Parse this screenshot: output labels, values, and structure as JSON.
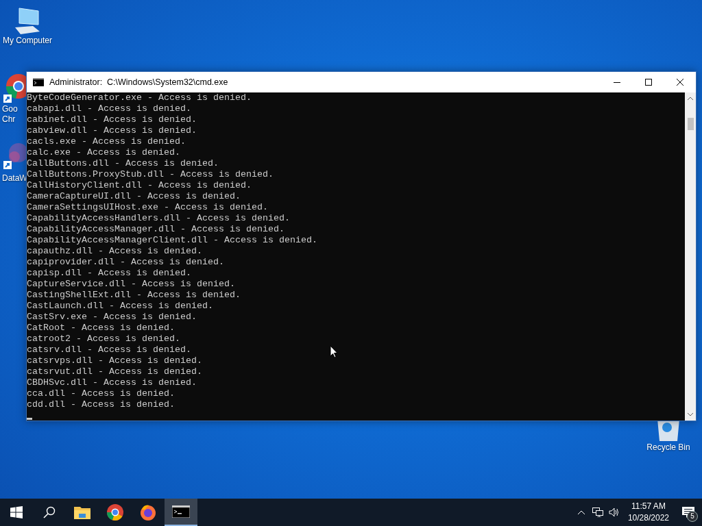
{
  "desktop": {
    "icons": [
      {
        "kind": "computer",
        "label_lines": [
          "My Computer"
        ]
      },
      {
        "kind": "chrome",
        "label_lines": [
          "Goo",
          "Chr"
        ]
      },
      {
        "kind": "app",
        "label_lines": [
          "DataW"
        ]
      },
      {
        "kind": "recycle",
        "label_lines": [
          "Recycle Bin"
        ]
      }
    ]
  },
  "window": {
    "title": "Administrator:  C:\\Windows\\System32\\cmd.exe",
    "lines": [
      "ByteCodeGenerator.exe - Access is denied.",
      "cabapi.dll - Access is denied.",
      "cabinet.dll - Access is denied.",
      "cabview.dll - Access is denied.",
      "cacls.exe - Access is denied.",
      "calc.exe - Access is denied.",
      "CallButtons.dll - Access is denied.",
      "CallButtons.ProxyStub.dll - Access is denied.",
      "CallHistoryClient.dll - Access is denied.",
      "CameraCaptureUI.dll - Access is denied.",
      "CameraSettingsUIHost.exe - Access is denied.",
      "CapabilityAccessHandlers.dll - Access is denied.",
      "CapabilityAccessManager.dll - Access is denied.",
      "CapabilityAccessManagerClient.dll - Access is denied.",
      "capauthz.dll - Access is denied.",
      "capiprovider.dll - Access is denied.",
      "capisp.dll - Access is denied.",
      "CaptureService.dll - Access is denied.",
      "CastingShellExt.dll - Access is denied.",
      "CastLaunch.dll - Access is denied.",
      "CastSrv.exe - Access is denied.",
      "CatRoot - Access is denied.",
      "catroot2 - Access is denied.",
      "catsrv.dll - Access is denied.",
      "catsrvps.dll - Access is denied.",
      "catsrvut.dll - Access is denied.",
      "CBDHSvc.dll - Access is denied.",
      "cca.dll - Access is denied.",
      "cdd.dll - Access is denied."
    ]
  },
  "taskbar": {
    "apps": [
      {
        "kind": "explorer",
        "selected": false
      },
      {
        "kind": "chrome",
        "selected": false
      },
      {
        "kind": "firefox",
        "selected": false
      },
      {
        "kind": "terminal",
        "selected": true
      }
    ],
    "clock": {
      "time": "11:57 AM",
      "date": "10/28/2022"
    },
    "notifications": {
      "count": "5"
    }
  }
}
